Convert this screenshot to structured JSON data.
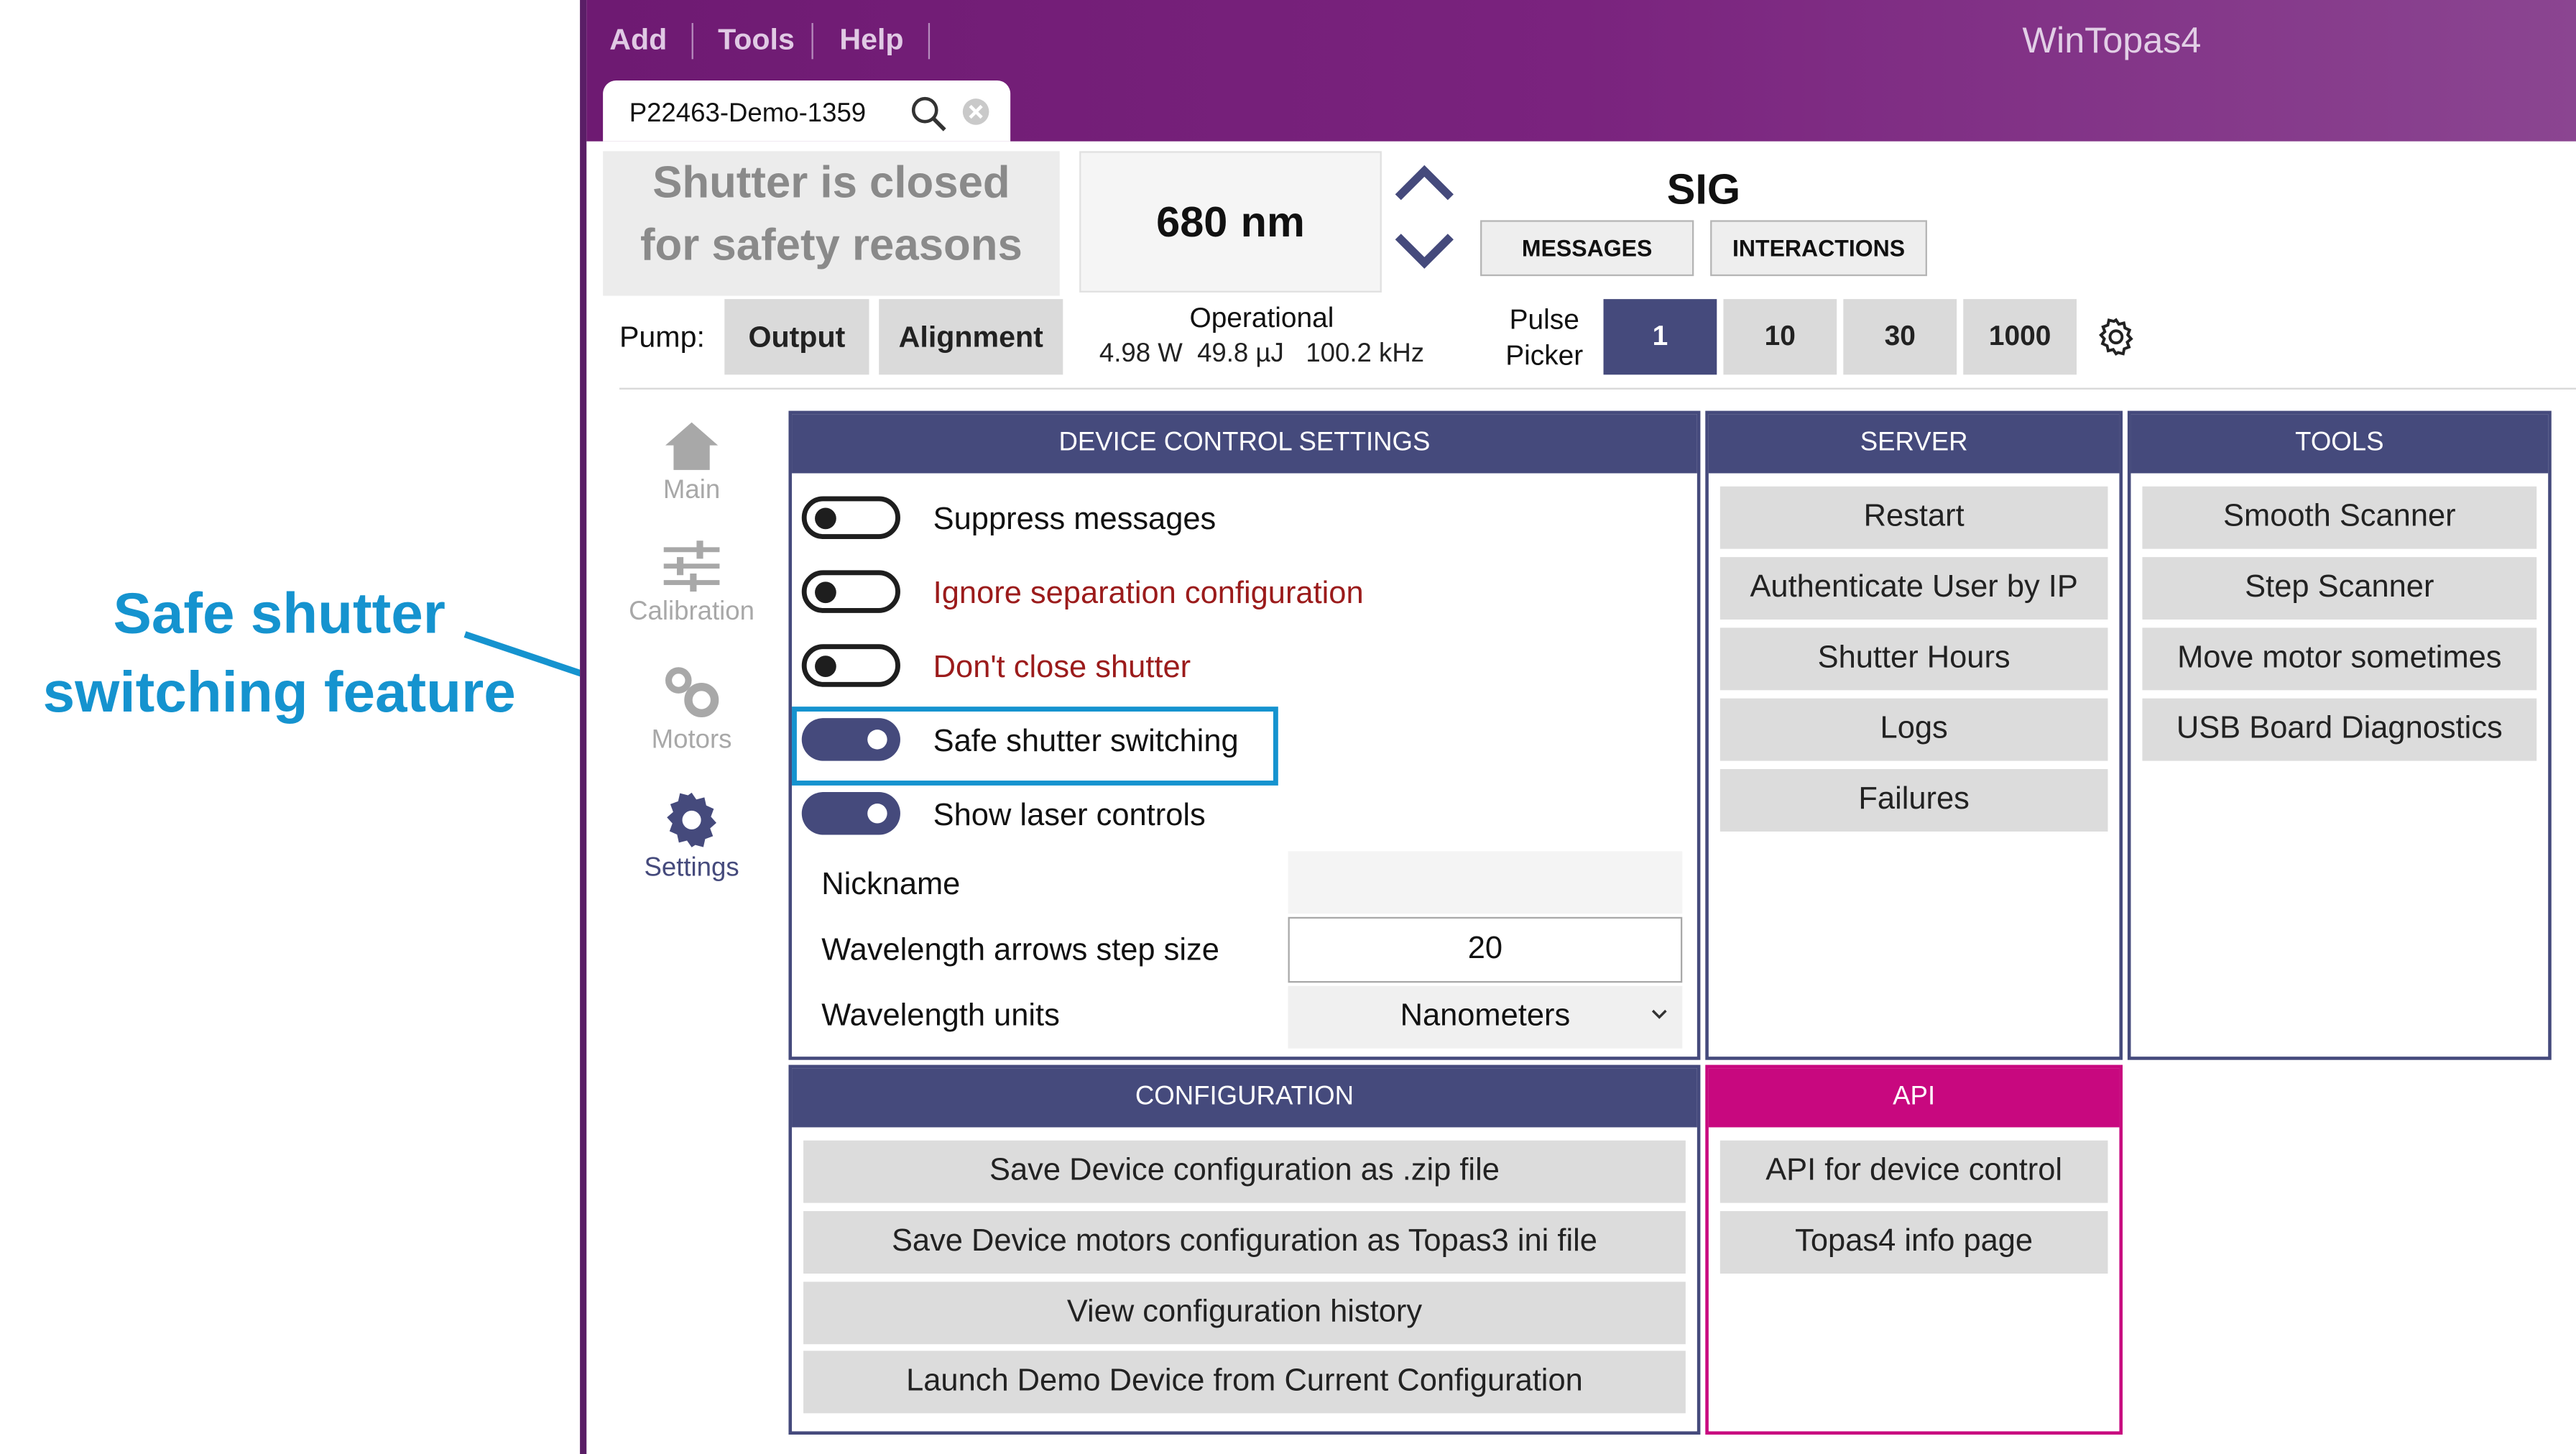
{
  "annotation": {
    "line1": "Safe shutter",
    "line2": "switching feature"
  },
  "menu": {
    "items": [
      "Add",
      "Tools",
      "Help"
    ]
  },
  "app_title": "WinTopas4",
  "tab": {
    "label": "P22463-Demo-1359"
  },
  "status": {
    "shutter_line1": "Shutter is closed",
    "shutter_line2": "for safety reasons",
    "wavelength_value": "680",
    "wavelength_unit": "nm",
    "sig": "SIG",
    "messages_button": "MESSAGES",
    "interactions_button": "INTERACTIONS"
  },
  "pump": {
    "label": "Pump:",
    "output_button": "Output",
    "alignment_button": "Alignment",
    "operational_label": "Operational",
    "power": "4.98 W",
    "energy": "49.8 µJ",
    "frequency": "100.2 kHz"
  },
  "pulse_picker": {
    "label_line1": "Pulse",
    "label_line2": "Picker",
    "options": [
      "1",
      "10",
      "30",
      "1000"
    ],
    "selected": "1"
  },
  "nav": {
    "items": [
      {
        "label": "Main",
        "icon": "home-icon"
      },
      {
        "label": "Calibration",
        "icon": "sliders-icon"
      },
      {
        "label": "Motors",
        "icon": "gears-icon"
      },
      {
        "label": "Settings",
        "icon": "gear-icon"
      }
    ],
    "active": "Settings"
  },
  "device_control": {
    "header": "DEVICE CONTROL SETTINGS",
    "toggles": [
      {
        "label": "Suppress messages",
        "on": false,
        "warning": false
      },
      {
        "label": "Ignore separation configuration",
        "on": false,
        "warning": true
      },
      {
        "label": "Don't close shutter",
        "on": false,
        "warning": true
      },
      {
        "label": "Safe shutter switching",
        "on": true,
        "warning": false
      },
      {
        "label": "Show laser controls",
        "on": true,
        "warning": false
      }
    ],
    "nickname_label": "Nickname",
    "nickname_value": "",
    "step_label": "Wavelength arrows step size",
    "step_value": "20",
    "units_label": "Wavelength units",
    "units_value": "Nanometers"
  },
  "server": {
    "header": "SERVER",
    "buttons": [
      "Restart",
      "Authenticate User by IP",
      "Shutter Hours",
      "Logs",
      "Failures"
    ]
  },
  "tools": {
    "header": "TOOLS",
    "buttons": [
      "Smooth Scanner",
      "Step Scanner",
      "Move motor sometimes",
      "USB Board Diagnostics"
    ]
  },
  "configuration": {
    "header": "CONFIGURATION",
    "buttons": [
      "Save Device configuration as .zip file",
      "Save Device motors configuration as Topas3 ini file",
      "View configuration history",
      "Launch Demo Device from Current Configuration"
    ]
  },
  "api": {
    "header": "API",
    "buttons": [
      "API for device control",
      "Topas4 info page"
    ]
  },
  "colors": {
    "accent": "#454a7c",
    "api_accent": "#c8087f",
    "annotation": "#1593cf",
    "warning_text": "#9b1b1b",
    "titlebar": "#7a237e"
  }
}
